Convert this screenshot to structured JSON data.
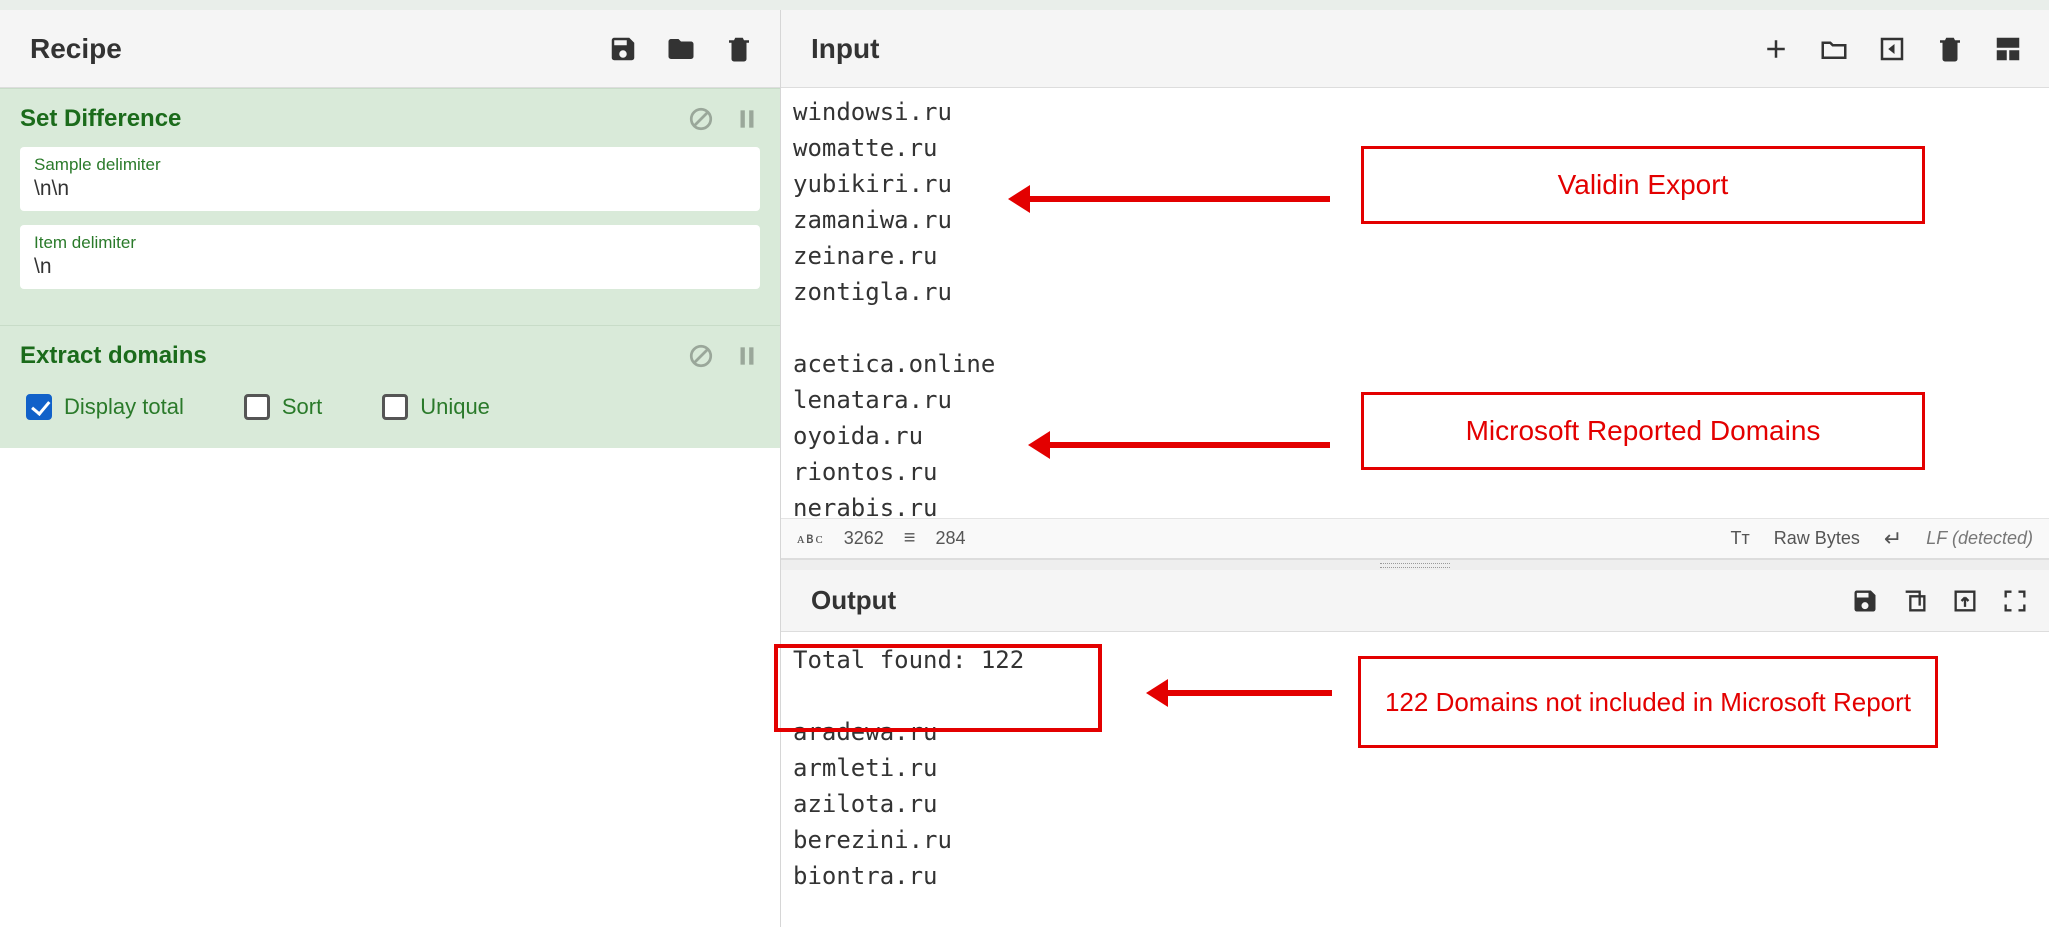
{
  "recipe": {
    "title": "Recipe",
    "operations": [
      {
        "name": "Set Difference",
        "fields": [
          {
            "label": "Sample delimiter",
            "value": "\\n\\n"
          },
          {
            "label": "Item delimiter",
            "value": "\\n"
          }
        ]
      },
      {
        "name": "Extract domains",
        "checkboxes": [
          {
            "label": "Display total",
            "checked": true
          },
          {
            "label": "Sort",
            "checked": false
          },
          {
            "label": "Unique",
            "checked": false
          }
        ]
      }
    ]
  },
  "input": {
    "title": "Input",
    "set1": [
      "windowsi.ru",
      "womatte.ru",
      "yubikiri.ru",
      "zamaniwa.ru",
      "zeinare.ru",
      "zontigla.ru"
    ],
    "set2": [
      "acetica.online",
      "lenatara.ru",
      "oyoida.ru",
      "riontos.ru",
      "nerabis.ru"
    ],
    "status": {
      "char_label": "ᴀʙᴄ",
      "chars": "3262",
      "line_icon": "≡",
      "lines": "284",
      "tt": "Tᴛ",
      "raw": "Raw Bytes",
      "eol_icon": "↵",
      "eol": "LF (detected)"
    }
  },
  "output": {
    "title": "Output",
    "total_line": "Total found: 122",
    "lines": [
      "aradewa.ru",
      "armleti.ru",
      "azilota.ru",
      "berezini.ru",
      "biontra.ru"
    ]
  },
  "annotations": {
    "a1": "Validin Export",
    "a2": "Microsoft Reported Domains",
    "a3": "122 Domains not included in Microsoft Report"
  }
}
